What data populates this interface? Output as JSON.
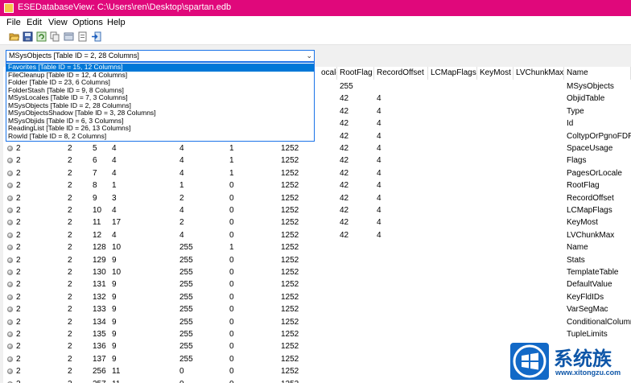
{
  "window": {
    "title": "ESEDatabaseView:   C:\\Users\\ren\\Desktop\\spartan.edb"
  },
  "menu": {
    "file": "File",
    "edit": "Edit",
    "view": "View",
    "options": "Options",
    "help": "Help"
  },
  "toolbar": {
    "icons": [
      "open-folder-icon",
      "save-icon",
      "refresh-icon",
      "copy-icon",
      "html-report-icon",
      "properties-icon",
      "exit-icon"
    ]
  },
  "table_selector": {
    "selected": "MSysObjects   [Table ID = 2, 28 Columns]",
    "options": [
      "Favorites   [Table ID = 15, 12 Columns]",
      "FileCleanup   [Table ID = 12, 4 Columns]",
      "Folder   [Table ID = 23, 6 Columns]",
      "FolderStash   [Table ID = 9, 8 Columns]",
      "MSysLocales   [Table ID = 7, 3 Columns]",
      "MSysObjects   [Table ID = 2, 28 Columns]",
      "MSysObjectsShadow   [Table ID = 3, 28 Columns]",
      "MSysObjids   [Table ID = 6, 3 Columns]",
      "ReadingList   [Table ID = 26, 13 Columns]",
      "RowId   [Table ID = 8, 2 Columns]"
    ],
    "highlighted_index": 0
  },
  "grid": {
    "headers": {
      "locale": "ocale",
      "root_flag": "RootFlag",
      "record_offset": "RecordOffset",
      "lc_map_flags": "LCMapFlags",
      "key_most": "KeyMost",
      "lv_chunk_max": "LVChunkMax",
      "name": "Name"
    },
    "hidden_rows": [
      {
        "root_flag": "255",
        "record_offset": "",
        "name": "MSysObjects"
      },
      {
        "root_flag": "42",
        "record_offset": "4",
        "name": "ObjidTable"
      },
      {
        "root_flag": "42",
        "record_offset": "4",
        "name": "Type"
      },
      {
        "root_flag": "42",
        "record_offset": "4",
        "name": "Id"
      },
      {
        "root_flag": "42",
        "record_offset": "4",
        "name": "ColtypOrPgnoFDP"
      }
    ],
    "rows": [
      {
        "c1": "2",
        "c2": "2",
        "c3": "5",
        "c4": "4",
        "c5": "4",
        "c6": "1",
        "locale": "1252",
        "root_flag": "42",
        "record_offset": "4",
        "name": "SpaceUsage"
      },
      {
        "c1": "2",
        "c2": "2",
        "c3": "6",
        "c4": "4",
        "c5": "4",
        "c6": "1",
        "locale": "1252",
        "root_flag": "42",
        "record_offset": "4",
        "name": "Flags"
      },
      {
        "c1": "2",
        "c2": "2",
        "c3": "7",
        "c4": "4",
        "c5": "4",
        "c6": "1",
        "locale": "1252",
        "root_flag": "42",
        "record_offset": "4",
        "name": "PagesOrLocale"
      },
      {
        "c1": "2",
        "c2": "2",
        "c3": "8",
        "c4": "1",
        "c5": "1",
        "c6": "0",
        "locale": "1252",
        "root_flag": "42",
        "record_offset": "4",
        "name": "RootFlag"
      },
      {
        "c1": "2",
        "c2": "2",
        "c3": "9",
        "c4": "3",
        "c5": "2",
        "c6": "0",
        "locale": "1252",
        "root_flag": "42",
        "record_offset": "4",
        "name": "RecordOffset"
      },
      {
        "c1": "2",
        "c2": "2",
        "c3": "10",
        "c4": "4",
        "c5": "4",
        "c6": "0",
        "locale": "1252",
        "root_flag": "42",
        "record_offset": "4",
        "name": "LCMapFlags"
      },
      {
        "c1": "2",
        "c2": "2",
        "c3": "11",
        "c4": "17",
        "c5": "2",
        "c6": "0",
        "locale": "1252",
        "root_flag": "42",
        "record_offset": "4",
        "name": "KeyMost"
      },
      {
        "c1": "2",
        "c2": "2",
        "c3": "12",
        "c4": "4",
        "c5": "4",
        "c6": "0",
        "locale": "1252",
        "root_flag": "42",
        "record_offset": "4",
        "name": "LVChunkMax"
      },
      {
        "c1": "2",
        "c2": "2",
        "c3": "128",
        "c4": "10",
        "c5": "255",
        "c6": "1",
        "locale": "1252",
        "root_flag": "",
        "record_offset": "",
        "name": "Name"
      },
      {
        "c1": "2",
        "c2": "2",
        "c3": "129",
        "c4": "9",
        "c5": "255",
        "c6": "0",
        "locale": "1252",
        "root_flag": "",
        "record_offset": "",
        "name": "Stats"
      },
      {
        "c1": "2",
        "c2": "2",
        "c3": "130",
        "c4": "10",
        "c5": "255",
        "c6": "0",
        "locale": "1252",
        "root_flag": "",
        "record_offset": "",
        "name": "TemplateTable"
      },
      {
        "c1": "2",
        "c2": "2",
        "c3": "131",
        "c4": "9",
        "c5": "255",
        "c6": "0",
        "locale": "1252",
        "root_flag": "",
        "record_offset": "",
        "name": "DefaultValue"
      },
      {
        "c1": "2",
        "c2": "2",
        "c3": "132",
        "c4": "9",
        "c5": "255",
        "c6": "0",
        "locale": "1252",
        "root_flag": "",
        "record_offset": "",
        "name": "KeyFldIDs"
      },
      {
        "c1": "2",
        "c2": "2",
        "c3": "133",
        "c4": "9",
        "c5": "255",
        "c6": "0",
        "locale": "1252",
        "root_flag": "",
        "record_offset": "",
        "name": "VarSegMac"
      },
      {
        "c1": "2",
        "c2": "2",
        "c3": "134",
        "c4": "9",
        "c5": "255",
        "c6": "0",
        "locale": "1252",
        "root_flag": "",
        "record_offset": "",
        "name": "ConditionalColumn"
      },
      {
        "c1": "2",
        "c2": "2",
        "c3": "135",
        "c4": "9",
        "c5": "255",
        "c6": "0",
        "locale": "1252",
        "root_flag": "",
        "record_offset": "",
        "name": "TupleLimits"
      },
      {
        "c1": "2",
        "c2": "2",
        "c3": "136",
        "c4": "9",
        "c5": "255",
        "c6": "0",
        "locale": "1252",
        "root_flag": "",
        "record_offset": "",
        "name": ""
      },
      {
        "c1": "2",
        "c2": "2",
        "c3": "137",
        "c4": "9",
        "c5": "255",
        "c6": "0",
        "locale": "1252",
        "root_flag": "",
        "record_offset": "",
        "name": ""
      },
      {
        "c1": "2",
        "c2": "2",
        "c3": "256",
        "c4": "11",
        "c5": "0",
        "c6": "0",
        "locale": "1252",
        "root_flag": "",
        "record_offset": "",
        "name": ""
      },
      {
        "c1": "2",
        "c2": "2",
        "c3": "257",
        "c4": "11",
        "c5": "0",
        "c6": "0",
        "locale": "1252",
        "root_flag": "",
        "record_offset": "",
        "name": ""
      }
    ]
  },
  "watermark": {
    "brand": "系统族",
    "url": "www.xitongzu.com"
  },
  "colors": {
    "titlebar": "#e0087b",
    "selection": "#0078d7",
    "dropdown_border": "#1a73e8"
  }
}
